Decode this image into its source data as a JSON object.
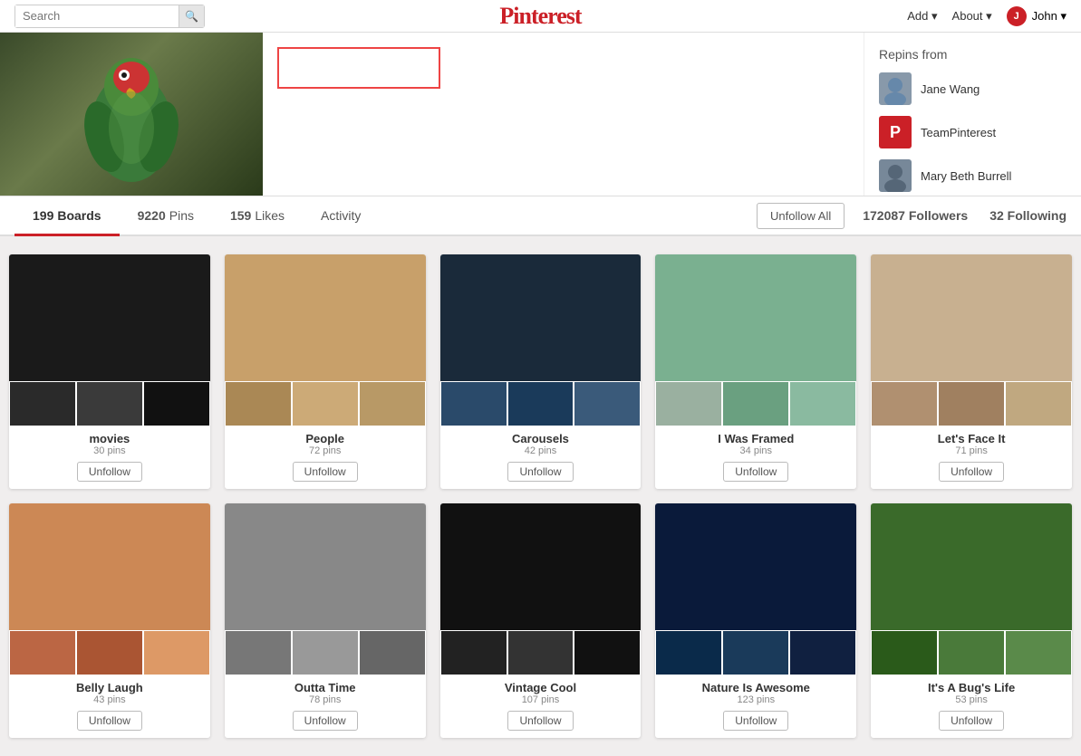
{
  "header": {
    "search_placeholder": "Search",
    "logo": "Pinterest",
    "add_label": "Add ▾",
    "about_label": "About ▾",
    "user_label": "John ▾",
    "user_initial": "J"
  },
  "profile": {
    "username_placeholder": "",
    "repins_from_title": "Repins from",
    "repin_persons": [
      {
        "name": "Jane Wang",
        "color": "#aabbcc"
      },
      {
        "name": "TeamPinterest",
        "color": "#cb2027"
      },
      {
        "name": "Mary Beth Burrell",
        "color": "#778899"
      }
    ]
  },
  "tabs": {
    "boards_count": "199",
    "boards_label": "Boards",
    "pins_count": "9220",
    "pins_label": "Pins",
    "likes_count": "159",
    "likes_label": "Likes",
    "activity_label": "Activity",
    "unfollow_all_label": "Unfollow All",
    "followers_count": "172087",
    "followers_label": "Followers",
    "following_count": "32",
    "following_label": "Following"
  },
  "boards": [
    {
      "title": "movies",
      "pins": "30 pins",
      "color1": "#1a1a1a",
      "color2": "#333",
      "color3": "#555",
      "color4": "#222"
    },
    {
      "title": "People",
      "pins": "72 pins",
      "color1": "#c8a06a",
      "color2": "#aa8855",
      "color3": "#887744",
      "color4": "#bb9966"
    },
    {
      "title": "Carousels",
      "pins": "42 pins",
      "color1": "#1a2a3a",
      "color2": "#2a4a6a",
      "color3": "#1a3a5a",
      "color4": "#3a5a7a"
    },
    {
      "title": "I Was Framed",
      "pins": "34 pins",
      "color1": "#7ab090",
      "color2": "#5a9070",
      "color3": "#9ab0a0",
      "color4": "#6aa080"
    },
    {
      "title": "Let's Face It",
      "pins": "71 pins",
      "color1": "#c8b090",
      "color2": "#b09070",
      "color3": "#a08060",
      "color4": "#c0a880"
    },
    {
      "title": "Belly Laugh",
      "pins": "43 pins",
      "color1": "#c87a50",
      "color2": "#b86a40",
      "color3": "#a85a30",
      "color4": "#d88a60"
    },
    {
      "title": "Outta Time",
      "pins": "78 pins",
      "color1": "#888888",
      "color2": "#777777",
      "color3": "#999999",
      "color4": "#666666"
    },
    {
      "title": "Vintage Cool",
      "pins": "107 pins",
      "color1": "#1a1a1a",
      "color2": "#2a2a2a",
      "color3": "#333333",
      "color4": "#111111"
    },
    {
      "title": "Nature Is Awesome",
      "pins": "123 pins",
      "color1": "#1a3a5a",
      "color2": "#0a2a4a",
      "color3": "#2a4a6a",
      "color4": "#1a4a6a"
    },
    {
      "title": "It's A Bug's Life",
      "pins": "53 pins",
      "color1": "#4a6a2a",
      "color2": "#3a5a1a",
      "color3": "#5a7a3a",
      "color4": "#6a8a4a"
    }
  ]
}
